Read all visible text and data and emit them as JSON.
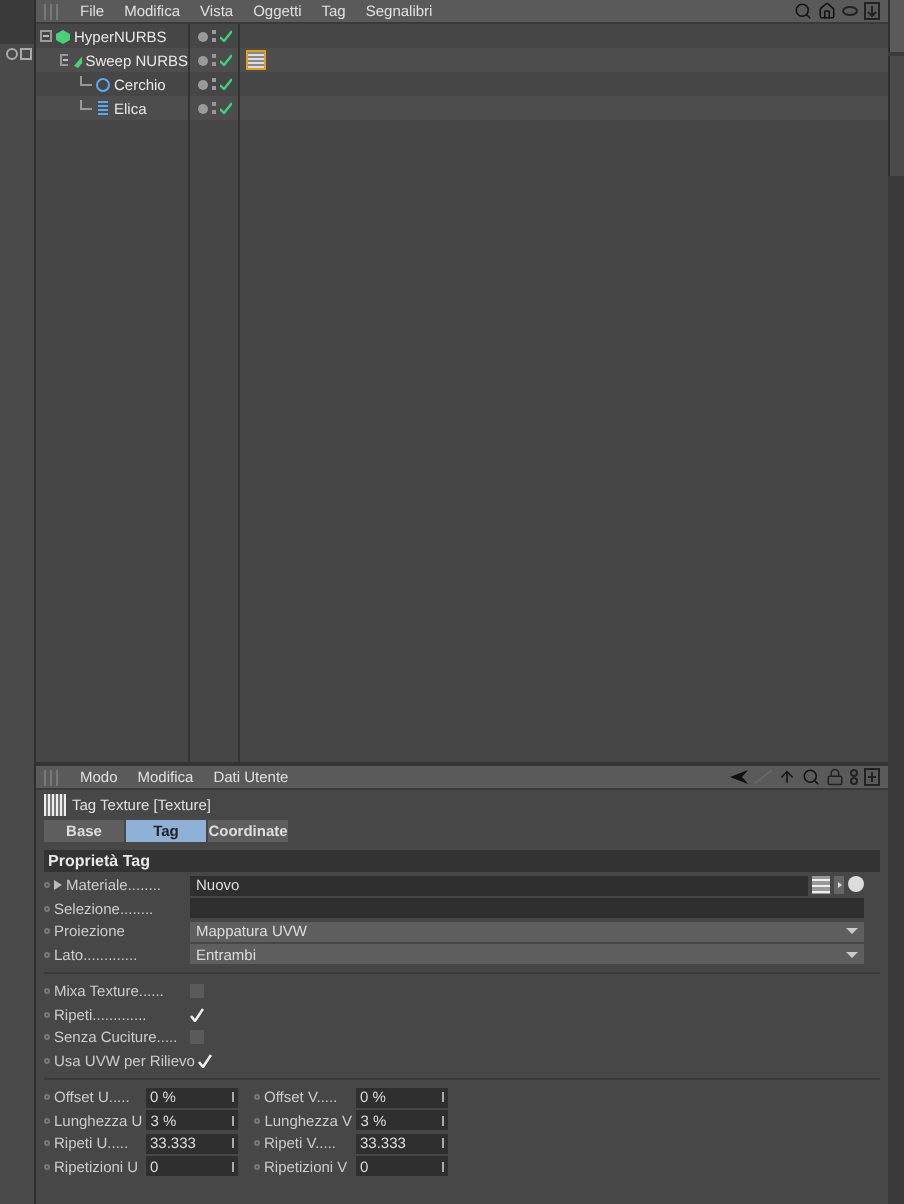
{
  "object_manager": {
    "menu": [
      "File",
      "Modifica",
      "Vista",
      "Oggetti",
      "Tag",
      "Segnalibri"
    ],
    "tree": [
      {
        "name": "HyperNURBS",
        "kind": "hypernurbs",
        "expanded": true,
        "visible": true,
        "enabled": true,
        "children": [
          {
            "name": "Sweep NURBS",
            "kind": "sweep",
            "expanded": true,
            "visible": true,
            "enabled": true,
            "tags": [
              {
                "kind": "texture",
                "selected": true
              }
            ],
            "children": [
              {
                "name": "Cerchio",
                "kind": "circle",
                "visible": true,
                "enabled": true
              },
              {
                "name": "Elica",
                "kind": "helix",
                "visible": true,
                "enabled": true
              }
            ]
          }
        ]
      }
    ]
  },
  "attribute_manager": {
    "menu": [
      "Modo",
      "Modifica",
      "Dati Utente"
    ],
    "title": "Tag Texture [Texture]",
    "tabs": [
      {
        "label": "Base",
        "selected": false
      },
      {
        "label": "Tag",
        "selected": true
      },
      {
        "label": "Coordinate",
        "selected": false
      }
    ],
    "section": "Proprietà Tag",
    "fields": [
      {
        "kind": "link",
        "label": "Materiale........",
        "value": "Nuovo"
      },
      {
        "kind": "text",
        "label": "Selezione........"
      },
      {
        "kind": "dropdown",
        "label": "Proiezione",
        "value": "Mappatura UVW"
      },
      {
        "kind": "dropdown",
        "label": "Lato.............",
        "value": "Entrambi"
      }
    ],
    "checkboxes": [
      {
        "label": "Mixa Texture......",
        "checked": false
      },
      {
        "label": "Ripeti.............",
        "checked": true
      },
      {
        "label": "Senza Cuciture.....",
        "checked": false
      },
      {
        "label": "Usa UVW per Rilievo",
        "checked": true
      }
    ],
    "numbers": [
      [
        {
          "label": "Offset U.....",
          "value": "0 %"
        },
        {
          "label": "Offset V.....",
          "value": "0 %"
        }
      ],
      [
        {
          "label": "Lunghezza U",
          "value": "3 %"
        },
        {
          "label": "Lunghezza V",
          "value": "3 %"
        }
      ],
      [
        {
          "label": "Ripeti U.....",
          "value": "33.333"
        },
        {
          "label": "Ripeti V.....",
          "value": "33.333"
        }
      ],
      [
        {
          "label": "Ripetizioni U",
          "value": "0"
        },
        {
          "label": "Ripetizioni V",
          "value": "0"
        }
      ]
    ]
  }
}
